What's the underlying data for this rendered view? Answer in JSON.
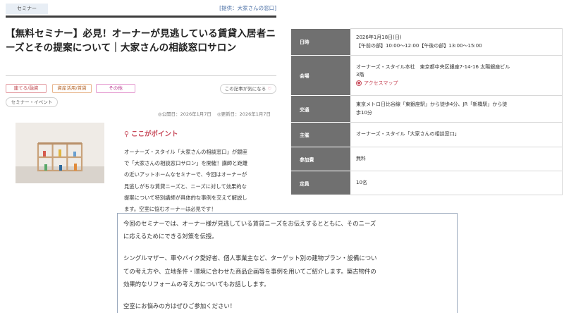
{
  "header": {
    "tag": "セミナー",
    "provider": "[提供：大家さんの窓口]"
  },
  "title": "【無料セミナー】必見！オーナーが見逃している賃貸入居者ニーズとその提案について｜大家さんの相談窓口サロン",
  "categories": [
    "建てる/融資",
    "資産活用/賃貸",
    "その他"
  ],
  "favorite": {
    "label": "この記事が気になる",
    "icon": "heart-icon"
  },
  "event_tag": "セミナー・イベント",
  "dates": {
    "published": "◎公開日：2026年1月7日",
    "updated": "◎更新日：2026年1月7日"
  },
  "point": {
    "icon": "map-pin-icon",
    "heading": "ここがポイント",
    "lines": [
      "オーナーズ・スタイル「大家さんの相談窓口」が銀座",
      "で「大家さんの相談窓口サロン」を開催！講師と距離",
      "の近いアットホームなセミナーで、今回はオーナーが",
      "見逃しがちな賃貸ニーズと、ニーズに対して効果的な",
      "提案について特別講師が具体的な事例を交えて解説し",
      "ます。空室に悩むオーナーは必見です！"
    ]
  },
  "info": {
    "rows": [
      {
        "label": "日時",
        "lines": [
          "2026年1月18日(日)",
          "【午前の部】10:00～12:00【午後の部】13:00～15:00"
        ]
      },
      {
        "label": "会場",
        "lines": [
          "オーナーズ・スタイル本社　東京都中央区銀座7-14-16 太陽銀座ビル",
          "3階"
        ],
        "link": "アクセスマップ"
      },
      {
        "label": "交通",
        "lines": [
          "東京メトロ日比谷線「東銀座駅」から徒歩4分、JR「新橋駅」から徒",
          "歩10分"
        ]
      },
      {
        "label": "主催",
        "lines": [
          "オーナーズ・スタイル「大家さんの相談窓口」"
        ]
      },
      {
        "label": "参加費",
        "lines": [
          "無料"
        ]
      },
      {
        "label": "定員",
        "lines": [
          "10名"
        ]
      }
    ]
  },
  "detail": {
    "p1": [
      "今回のセミナーでは、オーナー様が見逃している賃貸ニーズをお伝えするとともに、そのニーズ",
      "に応えるためにできる対策を伝授。"
    ],
    "p2": [
      "シングルマザー、車やバイク愛好者、個人事業主など、ターゲット別の建物プラン・設備につい",
      "ての考え方や、立地条件・環境に合わせた商品企画等を事例を用いてご紹介します。築古物件の",
      "効果的なリフォームの考え方についてもお話しします。"
    ],
    "p3": [
      "空室にお悩みの方はぜひご参加ください！"
    ]
  }
}
